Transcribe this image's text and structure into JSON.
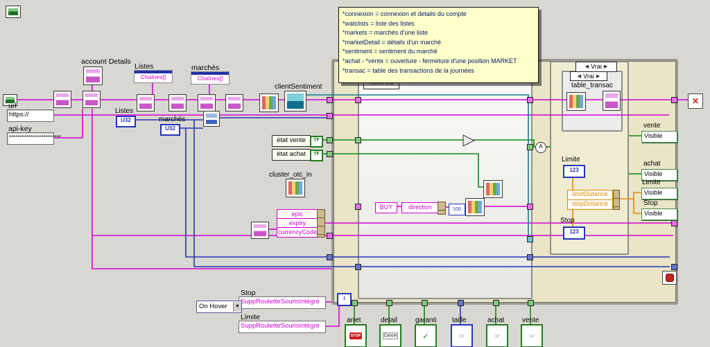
{
  "comment": {
    "lines": [
      "*connexion = connexion et details du compte",
      "*watclists = liste des listes",
      "*markets = marchés d'une liste",
      "*marketDetail = détails d'un marché",
      "*sentiment = sentiment du marché",
      "*achat - *vente = ouverture  - fermeture d'une position MARKET",
      "*transac = table des transactions de la journées"
    ]
  },
  "nodes": {
    "account_details": "account Details",
    "listes": "Listes",
    "marches": "marchés",
    "chaines": "Chaînes[]",
    "client_sentiment": "clientSentiment",
    "url_label": "url",
    "url_value": " https:// ",
    "api_key_label": "api-key",
    "api_key_value": "************************",
    "u32": "U32",
    "etat_vente": "état vente",
    "etat_achat": "état achat",
    "tf": "TF",
    "cluster_otc": "cluster_otc_in",
    "epic": "epic",
    "expiry": "expiry",
    "currency_code": "currencyCode",
    "stop": "Stop",
    "limite": "Limite",
    "supp_roulette": "SuppRouletteSourisIntégré",
    "on_hover": "On Hover",
    "nouvval": "NouvVal",
    "buy": "BUY",
    "direction": "direction",
    "const_100": "100",
    "vrai": "Vrai",
    "table_transac": "table_transac",
    "num123": "123",
    "limit_distance": "limitDistance",
    "stop_distance": "stopDistance",
    "vente": "vente",
    "achat": "achat",
    "visible": "Visible",
    "iteration": "i",
    "wire_label": "A"
  },
  "terminals": [
    {
      "label": "arret",
      "glyph": "STOP"
    },
    {
      "label": "detail",
      "glyph": "Cancel"
    },
    {
      "label": "garanti",
      "glyph": "✓"
    },
    {
      "label": "taille",
      "glyph": "☞"
    },
    {
      "label": "achat",
      "glyph": "☞"
    },
    {
      "label": "vente",
      "glyph": "☞"
    }
  ],
  "colors": {
    "string_wire": "#d400d4",
    "numeric_wire": "#2334b8",
    "boolean_wire": "#0f8a0f",
    "float_wire": "#e08b00",
    "teal_wire": "#0c7f92",
    "loop_background": "#e9e5c6",
    "comment_background": "#ffffc9"
  }
}
